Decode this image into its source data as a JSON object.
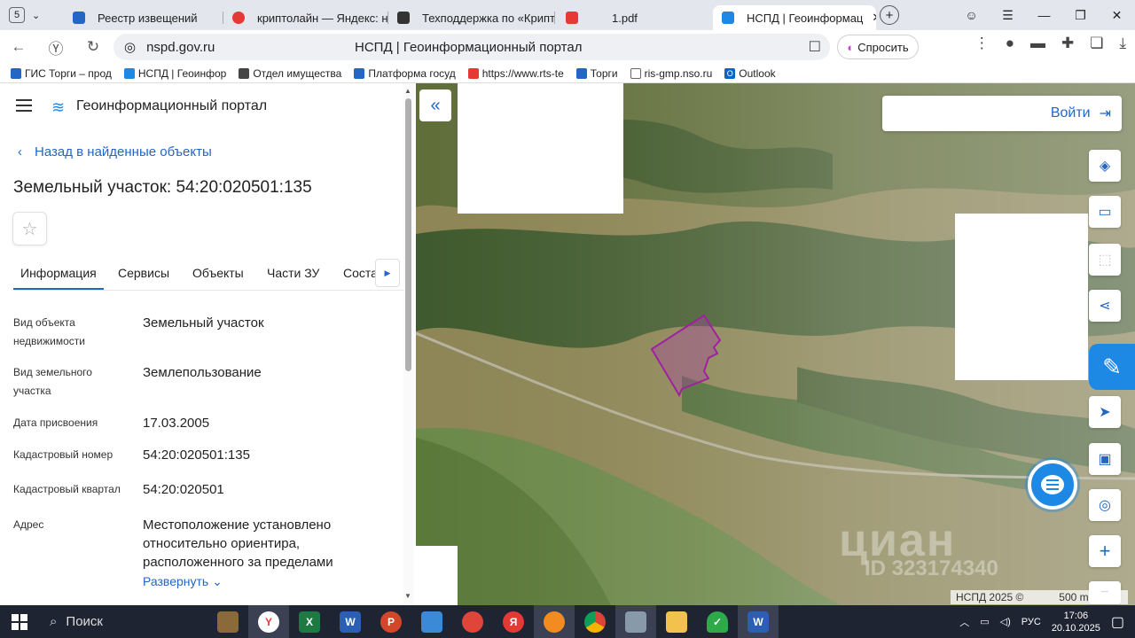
{
  "browser": {
    "tab_count": "5",
    "tabs": [
      {
        "label": "Реестр извещений",
        "color": "#2466c4"
      },
      {
        "label": "криптолайн — Яндекс: на",
        "color": "#e53935"
      },
      {
        "label": "Техподдержка по «Крипт",
        "color": "#333333"
      },
      {
        "label": "1.pdf",
        "color": "#e53935"
      },
      {
        "label": "НСПД | Геоинформац",
        "color": "#1e88e5"
      }
    ],
    "new_tab_label": "+",
    "url_domain": "nspd.gov.ru",
    "page_title": "НСПД | Геоинформационный портал",
    "ask_label": "Спросить",
    "bookmarks": [
      {
        "label": "ГИС Торги – прод",
        "color": "#2466c4"
      },
      {
        "label": "НСПД | Геоинфор",
        "color": "#1e88e5"
      },
      {
        "label": "Отдел имущества",
        "color": "#444444"
      },
      {
        "label": "Платформа госуд",
        "color": "#2466c4"
      },
      {
        "label": "https://www.rts-te",
        "color": "#e53935"
      },
      {
        "label": "Торги",
        "color": "#2466c4"
      },
      {
        "label": "ris-gmp.nso.ru",
        "color": "#666666"
      },
      {
        "label": "Outlook",
        "color": "#0a64c8"
      }
    ]
  },
  "panel": {
    "portal_title": "Геоинформационный портал",
    "back_label": "Назад в найденные объекты",
    "object_title": "Земельный участок: 54:20:020501:135",
    "tabs": [
      "Информация",
      "Сервисы",
      "Объекты",
      "Части ЗУ",
      "Соста"
    ],
    "fields": [
      {
        "key": "Вид объекта недвижимости",
        "value": "Земельный участок"
      },
      {
        "key": "Вид земельного участка",
        "value": "Землепользование"
      },
      {
        "key": "Дата присвоения",
        "value": "17.03.2005"
      },
      {
        "key": "Кадастровый номер",
        "value": "54:20:020501:135"
      },
      {
        "key": "Кадастровый квартал",
        "value": "54:20:020501"
      },
      {
        "key": "Адрес",
        "value": "Местоположение установлено относительно ориентира, расположенного за пределами"
      }
    ],
    "expand_label": "Развернуть"
  },
  "map": {
    "login_label": "Войти",
    "copyright": "НСПД 2025 ©",
    "scale": "500 m",
    "watermark": "циан",
    "watermark_id": "ID 323174340",
    "parcel_color": "#a020a0"
  },
  "taskbar": {
    "search_label": "Поиск",
    "lang": "РУС",
    "time": "17:06",
    "date": "20.10.2025"
  }
}
